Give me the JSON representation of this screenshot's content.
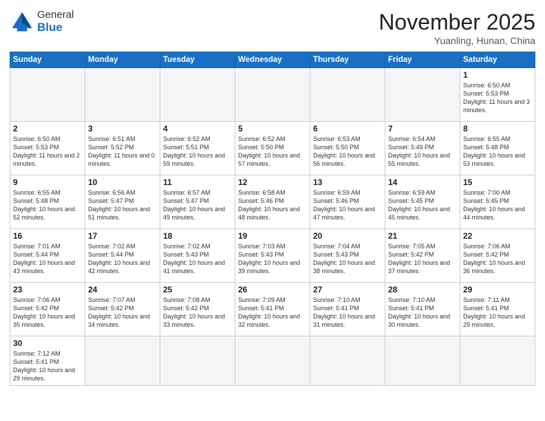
{
  "header": {
    "logo_general": "General",
    "logo_blue": "Blue",
    "month_title": "November 2025",
    "location": "Yuanling, Hunan, China"
  },
  "days_of_week": [
    "Sunday",
    "Monday",
    "Tuesday",
    "Wednesday",
    "Thursday",
    "Friday",
    "Saturday"
  ],
  "weeks": [
    [
      {
        "day": "",
        "content": ""
      },
      {
        "day": "",
        "content": ""
      },
      {
        "day": "",
        "content": ""
      },
      {
        "day": "",
        "content": ""
      },
      {
        "day": "",
        "content": ""
      },
      {
        "day": "",
        "content": ""
      },
      {
        "day": "1",
        "content": "Sunrise: 6:50 AM\nSunset: 5:53 PM\nDaylight: 11 hours\nand 3 minutes."
      }
    ],
    [
      {
        "day": "2",
        "content": "Sunrise: 6:50 AM\nSunset: 5:53 PM\nDaylight: 11 hours\nand 2 minutes."
      },
      {
        "day": "3",
        "content": "Sunrise: 6:51 AM\nSunset: 5:52 PM\nDaylight: 11 hours\nand 0 minutes."
      },
      {
        "day": "4",
        "content": "Sunrise: 6:52 AM\nSunset: 5:51 PM\nDaylight: 10 hours\nand 59 minutes."
      },
      {
        "day": "5",
        "content": "Sunrise: 6:52 AM\nSunset: 5:50 PM\nDaylight: 10 hours\nand 57 minutes."
      },
      {
        "day": "6",
        "content": "Sunrise: 6:53 AM\nSunset: 5:50 PM\nDaylight: 10 hours\nand 56 minutes."
      },
      {
        "day": "7",
        "content": "Sunrise: 6:54 AM\nSunset: 5:49 PM\nDaylight: 10 hours\nand 55 minutes."
      },
      {
        "day": "8",
        "content": "Sunrise: 6:55 AM\nSunset: 5:48 PM\nDaylight: 10 hours\nand 53 minutes."
      }
    ],
    [
      {
        "day": "9",
        "content": "Sunrise: 6:55 AM\nSunset: 5:48 PM\nDaylight: 10 hours\nand 52 minutes."
      },
      {
        "day": "10",
        "content": "Sunrise: 6:56 AM\nSunset: 5:47 PM\nDaylight: 10 hours\nand 51 minutes."
      },
      {
        "day": "11",
        "content": "Sunrise: 6:57 AM\nSunset: 5:47 PM\nDaylight: 10 hours\nand 49 minutes."
      },
      {
        "day": "12",
        "content": "Sunrise: 6:58 AM\nSunset: 5:46 PM\nDaylight: 10 hours\nand 48 minutes."
      },
      {
        "day": "13",
        "content": "Sunrise: 6:59 AM\nSunset: 5:46 PM\nDaylight: 10 hours\nand 47 minutes."
      },
      {
        "day": "14",
        "content": "Sunrise: 6:59 AM\nSunset: 5:45 PM\nDaylight: 10 hours\nand 45 minutes."
      },
      {
        "day": "15",
        "content": "Sunrise: 7:00 AM\nSunset: 5:45 PM\nDaylight: 10 hours\nand 44 minutes."
      }
    ],
    [
      {
        "day": "16",
        "content": "Sunrise: 7:01 AM\nSunset: 5:44 PM\nDaylight: 10 hours\nand 43 minutes."
      },
      {
        "day": "17",
        "content": "Sunrise: 7:02 AM\nSunset: 5:44 PM\nDaylight: 10 hours\nand 42 minutes."
      },
      {
        "day": "18",
        "content": "Sunrise: 7:02 AM\nSunset: 5:43 PM\nDaylight: 10 hours\nand 41 minutes."
      },
      {
        "day": "19",
        "content": "Sunrise: 7:03 AM\nSunset: 5:43 PM\nDaylight: 10 hours\nand 39 minutes."
      },
      {
        "day": "20",
        "content": "Sunrise: 7:04 AM\nSunset: 5:43 PM\nDaylight: 10 hours\nand 38 minutes."
      },
      {
        "day": "21",
        "content": "Sunrise: 7:05 AM\nSunset: 5:42 PM\nDaylight: 10 hours\nand 37 minutes."
      },
      {
        "day": "22",
        "content": "Sunrise: 7:06 AM\nSunset: 5:42 PM\nDaylight: 10 hours\nand 36 minutes."
      }
    ],
    [
      {
        "day": "23",
        "content": "Sunrise: 7:06 AM\nSunset: 5:42 PM\nDaylight: 10 hours\nand 35 minutes."
      },
      {
        "day": "24",
        "content": "Sunrise: 7:07 AM\nSunset: 5:42 PM\nDaylight: 10 hours\nand 34 minutes."
      },
      {
        "day": "25",
        "content": "Sunrise: 7:08 AM\nSunset: 5:42 PM\nDaylight: 10 hours\nand 33 minutes."
      },
      {
        "day": "26",
        "content": "Sunrise: 7:09 AM\nSunset: 5:41 PM\nDaylight: 10 hours\nand 32 minutes."
      },
      {
        "day": "27",
        "content": "Sunrise: 7:10 AM\nSunset: 5:41 PM\nDaylight: 10 hours\nand 31 minutes."
      },
      {
        "day": "28",
        "content": "Sunrise: 7:10 AM\nSunset: 5:41 PM\nDaylight: 10 hours\nand 30 minutes."
      },
      {
        "day": "29",
        "content": "Sunrise: 7:11 AM\nSunset: 5:41 PM\nDaylight: 10 hours\nand 29 minutes."
      }
    ],
    [
      {
        "day": "30",
        "content": "Sunrise: 7:12 AM\nSunset: 5:41 PM\nDaylight: 10 hours\nand 29 minutes."
      },
      {
        "day": "",
        "content": ""
      },
      {
        "day": "",
        "content": ""
      },
      {
        "day": "",
        "content": ""
      },
      {
        "day": "",
        "content": ""
      },
      {
        "day": "",
        "content": ""
      },
      {
        "day": "",
        "content": ""
      }
    ]
  ]
}
